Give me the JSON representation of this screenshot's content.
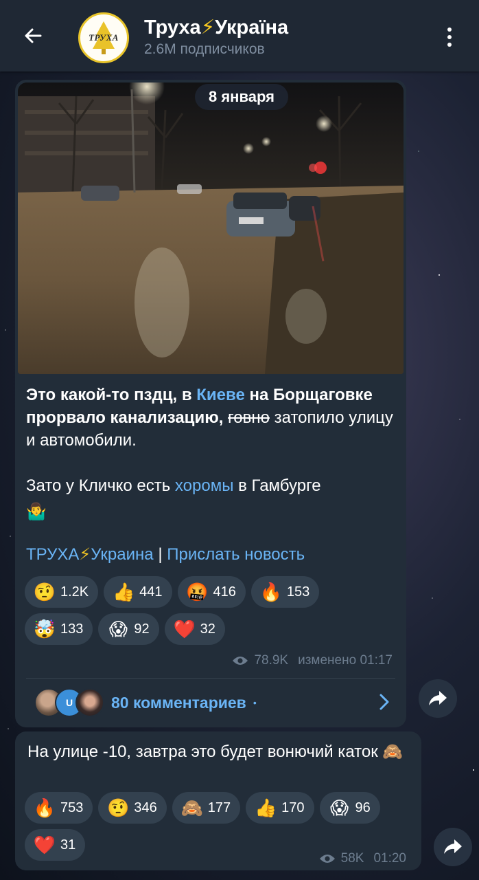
{
  "header": {
    "channel_name": "Труха",
    "channel_name_suffix": "Україна",
    "bolt": "⚡",
    "subscribers": "2.6M подписчиков",
    "avatar_text": "ТРУХА"
  },
  "date_divider": "8 января",
  "post1": {
    "text_a": "Это какой-то пздц, в ",
    "link_kiev": "Киеве",
    "text_b": " на Борщаговке прорвало канализацию, ",
    "strike_word": "говно",
    "text_c": " затопило улицу и автомобили.",
    "text_d": "Зато у Кличко есть ",
    "link_horomy": "хоромы",
    "text_e": " в Гамбурге",
    "shrug_emoji": "🤷‍♂️",
    "footer_link1_a": "ТРУХА",
    "footer_link1_b": "Украина",
    "footer_sep": "|",
    "footer_link2": "Прислать новость",
    "reactions": [
      {
        "emoji": "🤨",
        "count": "1.2K"
      },
      {
        "emoji": "👍",
        "count": "441"
      },
      {
        "emoji": "🤬",
        "count": "416"
      },
      {
        "emoji": "🔥",
        "count": "153"
      },
      {
        "emoji": "🤯",
        "count": "133"
      },
      {
        "emoji": "😱",
        "count": "92"
      },
      {
        "emoji": "❤️",
        "count": "32"
      }
    ],
    "views": "78.9K",
    "edited": "изменено 01:17",
    "comments_label": "80 комментариев",
    "comments_dot": "•",
    "avatar_letter": "U"
  },
  "post2": {
    "text": "На улице -10, завтра это будет вонючий каток ",
    "monkey_emoji": "🙈",
    "reactions": [
      {
        "emoji": "🔥",
        "count": "753"
      },
      {
        "emoji": "🤨",
        "count": "346"
      },
      {
        "emoji": "🙈",
        "count": "177"
      },
      {
        "emoji": "👍",
        "count": "170"
      },
      {
        "emoji": "😱",
        "count": "96"
      },
      {
        "emoji": "❤️",
        "count": "31"
      }
    ],
    "views": "58K",
    "time": "01:20"
  },
  "colors": {
    "header_bg": "#1f2834",
    "bubble_bg": "#222d39",
    "link": "#6ab4f5",
    "reaction_bg": "#33414f",
    "meta": "#6d7d8f",
    "bolt": "#f3c623"
  },
  "icons": {
    "back": "arrow-left-icon",
    "menu": "more-vertical-icon",
    "views": "eye-icon",
    "share": "share-arrow-icon",
    "chevron": "chevron-right-icon"
  }
}
